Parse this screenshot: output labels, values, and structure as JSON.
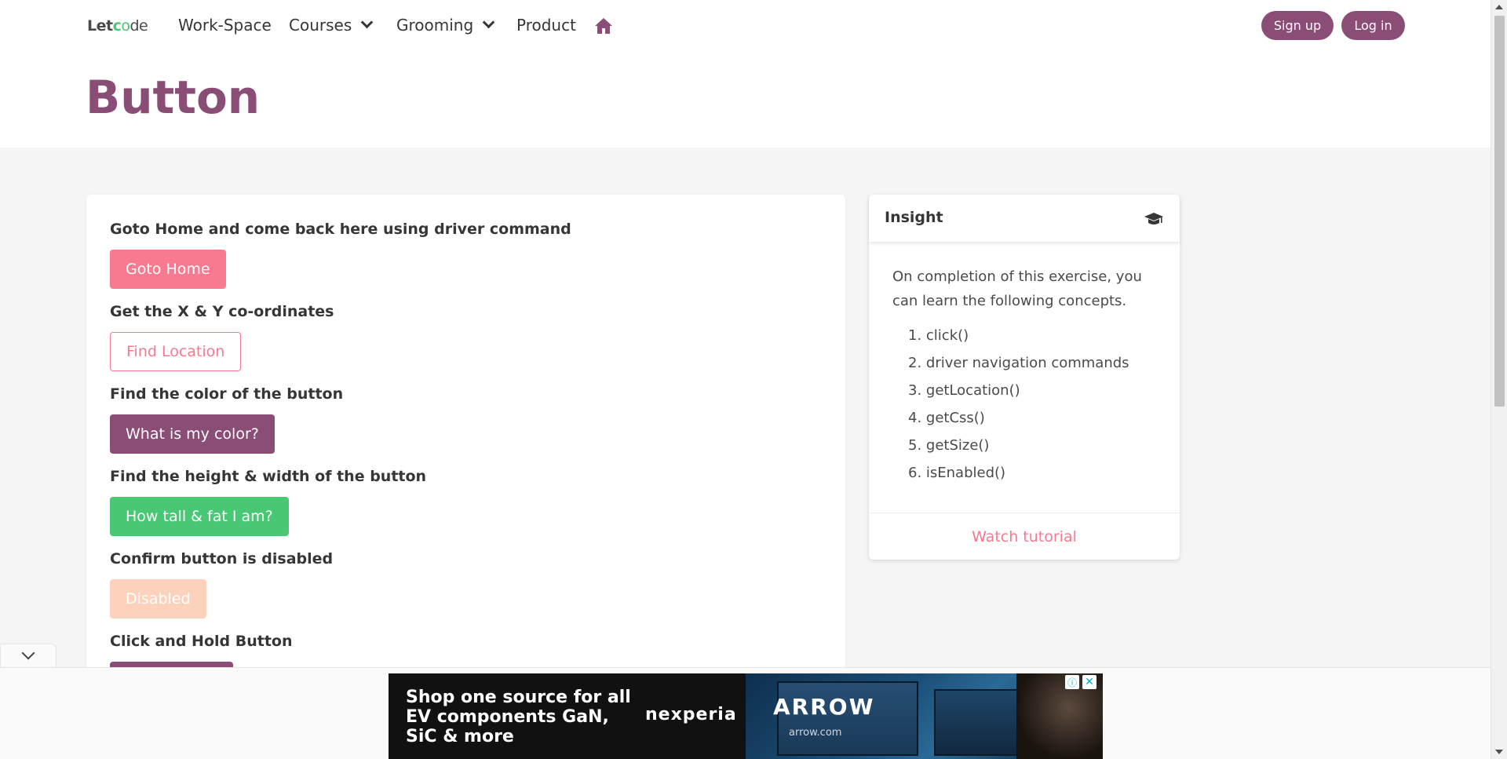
{
  "nav": {
    "brand_prefix": "Let",
    "brand_c": "c",
    "brand_o": "o",
    "brand_suffix": "de",
    "items": [
      "Work-Space",
      "Courses",
      "Grooming",
      "Product"
    ],
    "signup": "Sign up",
    "login": "Log in"
  },
  "page": {
    "title": "Button"
  },
  "exercises": [
    {
      "label": "Goto Home and come back here using driver command",
      "button": "Goto Home"
    },
    {
      "label": "Get the X & Y co-ordinates",
      "button": "Find Location"
    },
    {
      "label": "Find the color of the button",
      "button": "What is my color?"
    },
    {
      "label": "Find the height & width of the button",
      "button": "How tall & fat I am?"
    },
    {
      "label": "Confirm button is disabled",
      "button": "Disabled"
    },
    {
      "label": "Click and Hold Button"
    }
  ],
  "insight": {
    "title": "Insight",
    "intro": "On completion of this exercise, you can learn the following concepts.",
    "items": [
      "1. click()",
      "2. driver navigation commands",
      "3. getLocation()",
      "4. getCss()",
      "5. getSize()",
      "6. isEnabled()"
    ],
    "footer_link": "Watch tutorial"
  },
  "ad": {
    "text": "Shop one source for all EV components GaN, SiC & more",
    "brand": "nexperia",
    "logo": "ARROW",
    "sub": "arrow.com",
    "info_icon": "ⓘ",
    "close_icon": "✕"
  },
  "colors": {
    "accent_purple": "#8a4d76",
    "pink": "#f87a90",
    "green": "#48c774",
    "disabled": "#fcd2bd"
  }
}
